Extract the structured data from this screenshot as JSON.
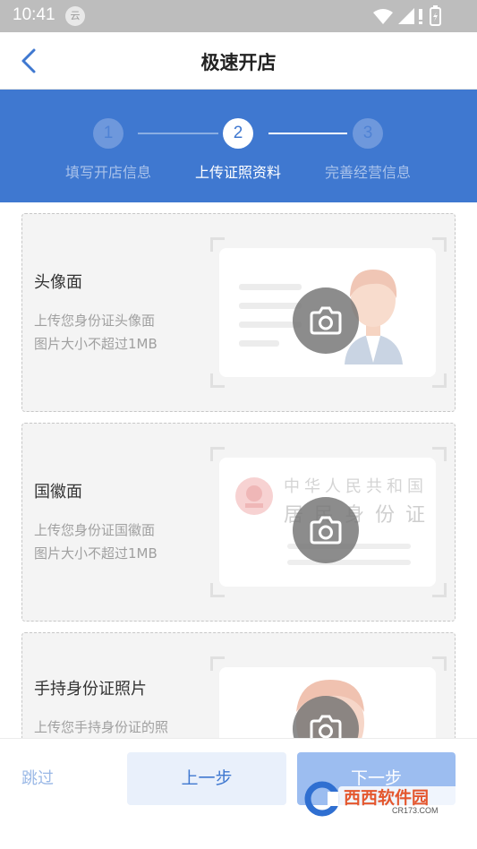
{
  "status_bar": {
    "time": "10:41",
    "cloud_badge": "云"
  },
  "header": {
    "title": "极速开店"
  },
  "steps": [
    {
      "number": "1",
      "label": "填写开店信息"
    },
    {
      "number": "2",
      "label": "上传证照资料"
    },
    {
      "number": "3",
      "label": "完善经营信息"
    }
  ],
  "cards": [
    {
      "title": "头像面",
      "desc_line1": "上传您身份证头像面",
      "desc_line2": "图片大小不超过1MB"
    },
    {
      "title": "国徽面",
      "desc_line1": "上传您身份证国徽面",
      "desc_line2": "图片大小不超过1MB",
      "id_text_line1": "中华人民共和国",
      "id_text_line2": "居民身份证"
    },
    {
      "title": "手持身份证照片",
      "desc_line1": "上传您手持身份证的照",
      "desc_line2": ""
    }
  ],
  "footer": {
    "skip_label": "跳过",
    "prev_label": "上一步",
    "next_label": "下一步"
  },
  "watermark": {
    "brand": "西西软件园",
    "url": "CR173.COM"
  },
  "colors": {
    "primary": "#3f78d0",
    "next_button": "#9cbdf0",
    "prev_button_bg": "#e9f0fb"
  }
}
